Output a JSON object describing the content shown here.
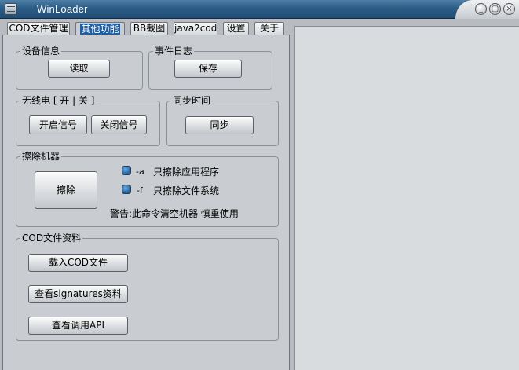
{
  "window": {
    "title": "WinLoader",
    "controls": {
      "minimize": "_",
      "restore": "▢",
      "close": "×"
    }
  },
  "tabs": [
    {
      "label": "COD文件管理"
    },
    {
      "label": "其他功能"
    },
    {
      "label": "BB截图"
    },
    {
      "label": "java2cod"
    },
    {
      "label": "设置"
    },
    {
      "label": "关于"
    }
  ],
  "device_info": {
    "title": "设备信息",
    "read_label": "读取"
  },
  "event_log": {
    "title": "事件日志",
    "save_label": "保存"
  },
  "radio": {
    "title": "无线电 [ 开 | 关 ]",
    "on_label": "开启信号",
    "off_label": "关闭信号"
  },
  "sync_time": {
    "title": "同步时间",
    "sync_label": "同步"
  },
  "wipe": {
    "title": "擦除机器",
    "wipe_label": "擦除",
    "option_a_flag": "-a",
    "option_a_label": "只擦除应用程序",
    "option_f_flag": "-f",
    "option_f_label": "只擦除文件系统",
    "warning": "警告:此命令清空机器 慎重使用"
  },
  "cod_info": {
    "title": "COD文件资料",
    "load_label": "载入COD文件",
    "signatures_label": "查看signatures资料",
    "api_label": "查看调用API"
  }
}
